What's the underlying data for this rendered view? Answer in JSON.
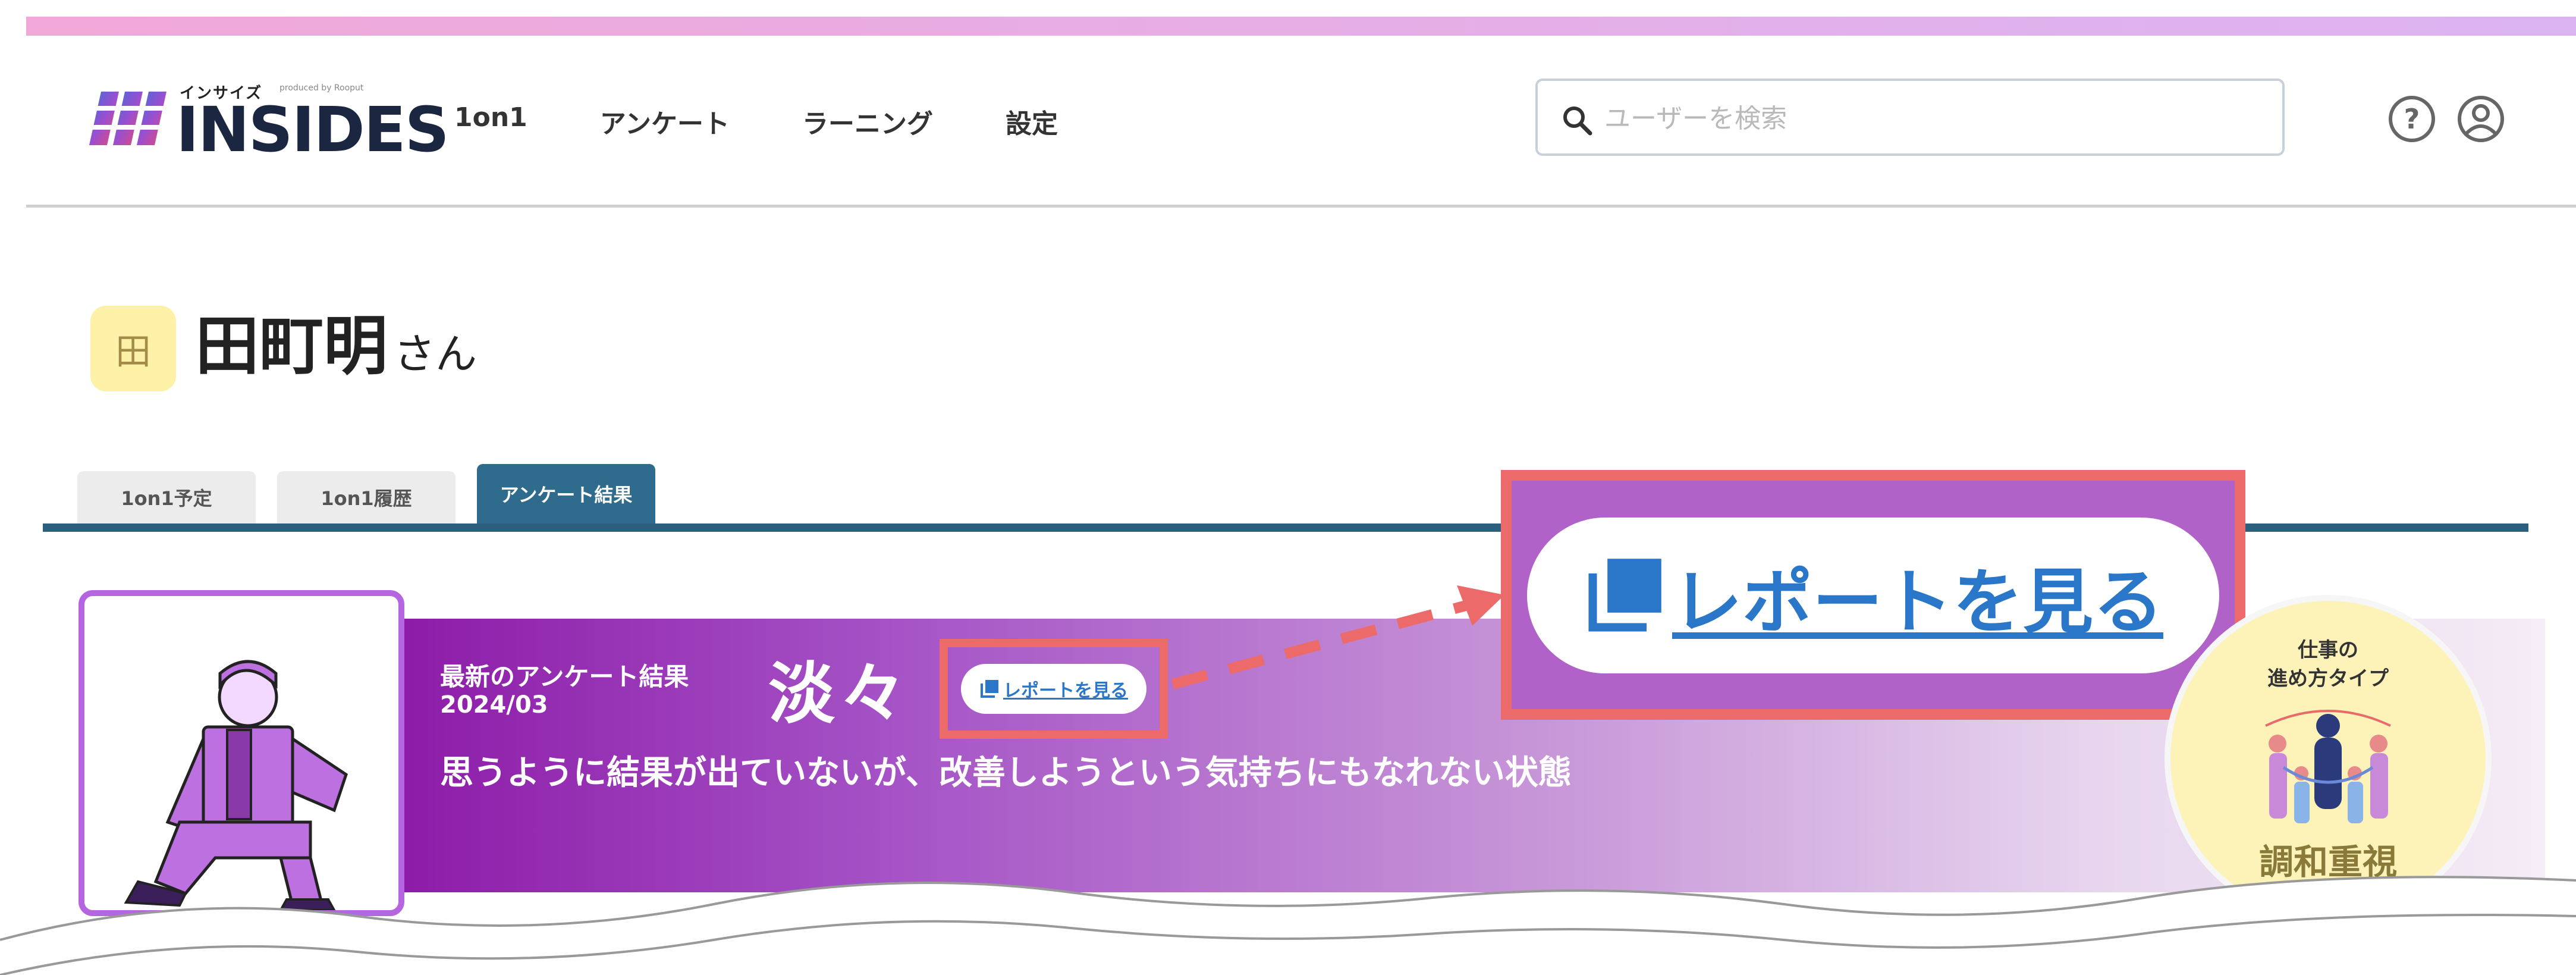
{
  "header": {
    "logo": {
      "kana": "インサイズ",
      "sub": "produced by Rooput",
      "text": "INSIDES"
    },
    "nav": [
      "1on1",
      "アンケート",
      "ラーニング",
      "設定"
    ],
    "search": {
      "placeholder": "ユーザーを検索",
      "value": ""
    }
  },
  "profile": {
    "avatar_char": "田",
    "name": "田町明",
    "suffix": "さん"
  },
  "tabs": [
    "1on1予定",
    "1on1履歴",
    "アンケート結果"
  ],
  "result": {
    "label": "最新のアンケート結果",
    "date": "2024/03",
    "value": "淡々",
    "report_label": "レポートを見る",
    "description": "思うように結果が出ていないが、改善しようという気持ちにもなれない状態"
  },
  "callout": {
    "report_label": "レポートを見る"
  },
  "work_type": {
    "title": "仕事の\n進め方タイプ",
    "name": "調和重視"
  },
  "colors": {
    "accent": "#2c5f7e",
    "purple": "#8d1ca8",
    "highlight": "#ec6a6a",
    "link": "#2a76c8"
  }
}
